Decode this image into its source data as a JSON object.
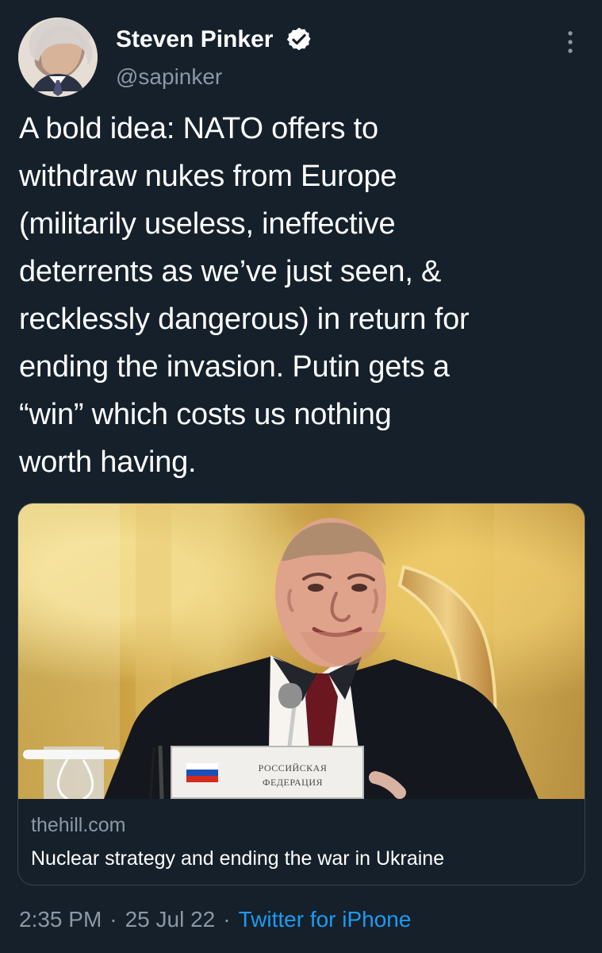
{
  "author": {
    "name": "Steven Pinker",
    "handle": "@sapinker",
    "avatar_icon": "avatar-photo",
    "verified_icon": "verified-badge-icon"
  },
  "menu": {
    "more_icon": "more-vertical-icon"
  },
  "tweet": {
    "text": "A bold idea: NATO offers to\nwithdraw nukes from Europe\n(militarily useless, ineffective\ndeterrents as we’ve just seen, &\nrecklessly dangerous) in return for\nending the invasion. Putin gets a\n“win” which costs us nothing\nworth having."
  },
  "link_card": {
    "domain": "thehill.com",
    "title": "Nuclear strategy and ending the war in Ukraine",
    "nameplate_line1": "РОССИЙСКАЯ",
    "nameplate_line2": "ФЕДЕРАЦИЯ"
  },
  "footer": {
    "time": "2:35 PM",
    "date": "25 Jul 22",
    "app": "Twitter for iPhone"
  },
  "colors": {
    "background": "#15202b",
    "accent": "#1d9bf0",
    "muted": "#8b98a5",
    "border": "#38444d"
  }
}
